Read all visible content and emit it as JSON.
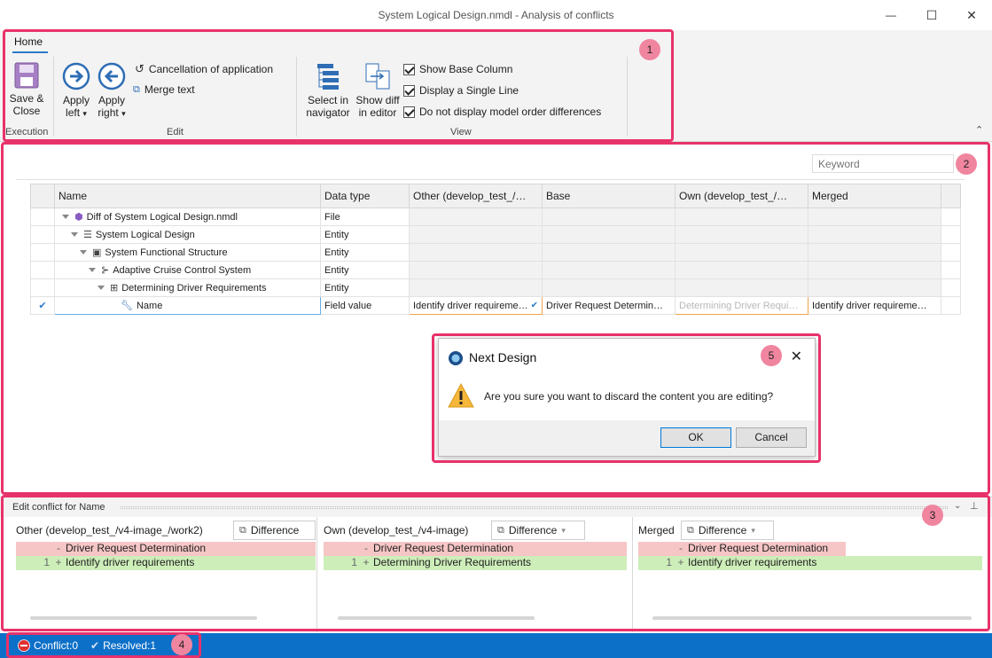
{
  "window": {
    "title": "System Logical Design.nmdl - Analysis of conflicts",
    "minimize_glyph": "—",
    "maximize_glyph": "☐",
    "close_glyph": "✕"
  },
  "ribbon": {
    "tab_home": "Home",
    "execution": {
      "save_close_line1": "Save &",
      "save_close_line2": "Close",
      "group_label": "Execution"
    },
    "edit": {
      "apply_left_line1": "Apply",
      "apply_left_line2": "left",
      "apply_right_line1": "Apply",
      "apply_right_line2": "right",
      "cancellation": "Cancellation of application",
      "merge_text": "Merge text",
      "group_label": "Edit"
    },
    "view": {
      "select_nav_line1": "Select in",
      "select_nav_line2": "navigator",
      "show_diff_line1": "Show diff",
      "show_diff_line2": "in editor",
      "show_base_column": "Show Base Column",
      "display_single_line": "Display a Single Line",
      "no_model_order": "Do not display model order differences",
      "group_label": "View"
    },
    "collapse_glyph": "⌃"
  },
  "callouts": [
    "1",
    "2",
    "3",
    "4",
    "5"
  ],
  "search": {
    "placeholder": "Keyword"
  },
  "grid": {
    "columns": [
      "Name",
      "Data type",
      "Other (develop_test_/…",
      "Base",
      "Own (develop_test_/…",
      "Merged"
    ],
    "rows": [
      {
        "name": "Diff of System Logical Design.nmdl",
        "type": "File"
      },
      {
        "name": "System Logical Design",
        "type": "Entity"
      },
      {
        "name": "System Functional Structure",
        "type": "Entity"
      },
      {
        "name": "Adaptive Cruise Control System",
        "type": "Entity"
      },
      {
        "name": "Determining Driver Requirements",
        "type": "Entity"
      },
      {
        "name": "Name",
        "type": "Field value",
        "other": "Identify driver requireme…",
        "base": "Driver Request Determin…",
        "own": "Determining Driver Requi…",
        "merged": "Identify driver requireme…"
      }
    ]
  },
  "dialog": {
    "title": "Next Design",
    "message": "Are you sure you want to discard the content you are editing?",
    "ok": "OK",
    "cancel": "Cancel"
  },
  "conflict_panel": {
    "title": "Edit conflict for Name",
    "panes": [
      {
        "label": "Other (develop_test_/v4-image_/work2)",
        "mode": "Difference",
        "removed": "Driver Request Determination",
        "added": "Identify driver requirements",
        "line_no": "1"
      },
      {
        "label": "Own (develop_test_/v4-image)",
        "mode": "Difference",
        "removed": "Driver Request Determination",
        "added": "Determining Driver Requirements",
        "line_no": "1"
      },
      {
        "label": "Merged",
        "mode": "Difference",
        "removed": "Driver Request Determination",
        "added": "Identify driver requirements",
        "line_no": "1"
      }
    ]
  },
  "status": {
    "conflict": "Conflict:0",
    "resolved": "Resolved:1"
  },
  "colors": {
    "accent": "#0d70c8",
    "callout": "#e8326a",
    "removed_bg": "#f6c6c6",
    "added_bg": "#cdeeb9"
  }
}
